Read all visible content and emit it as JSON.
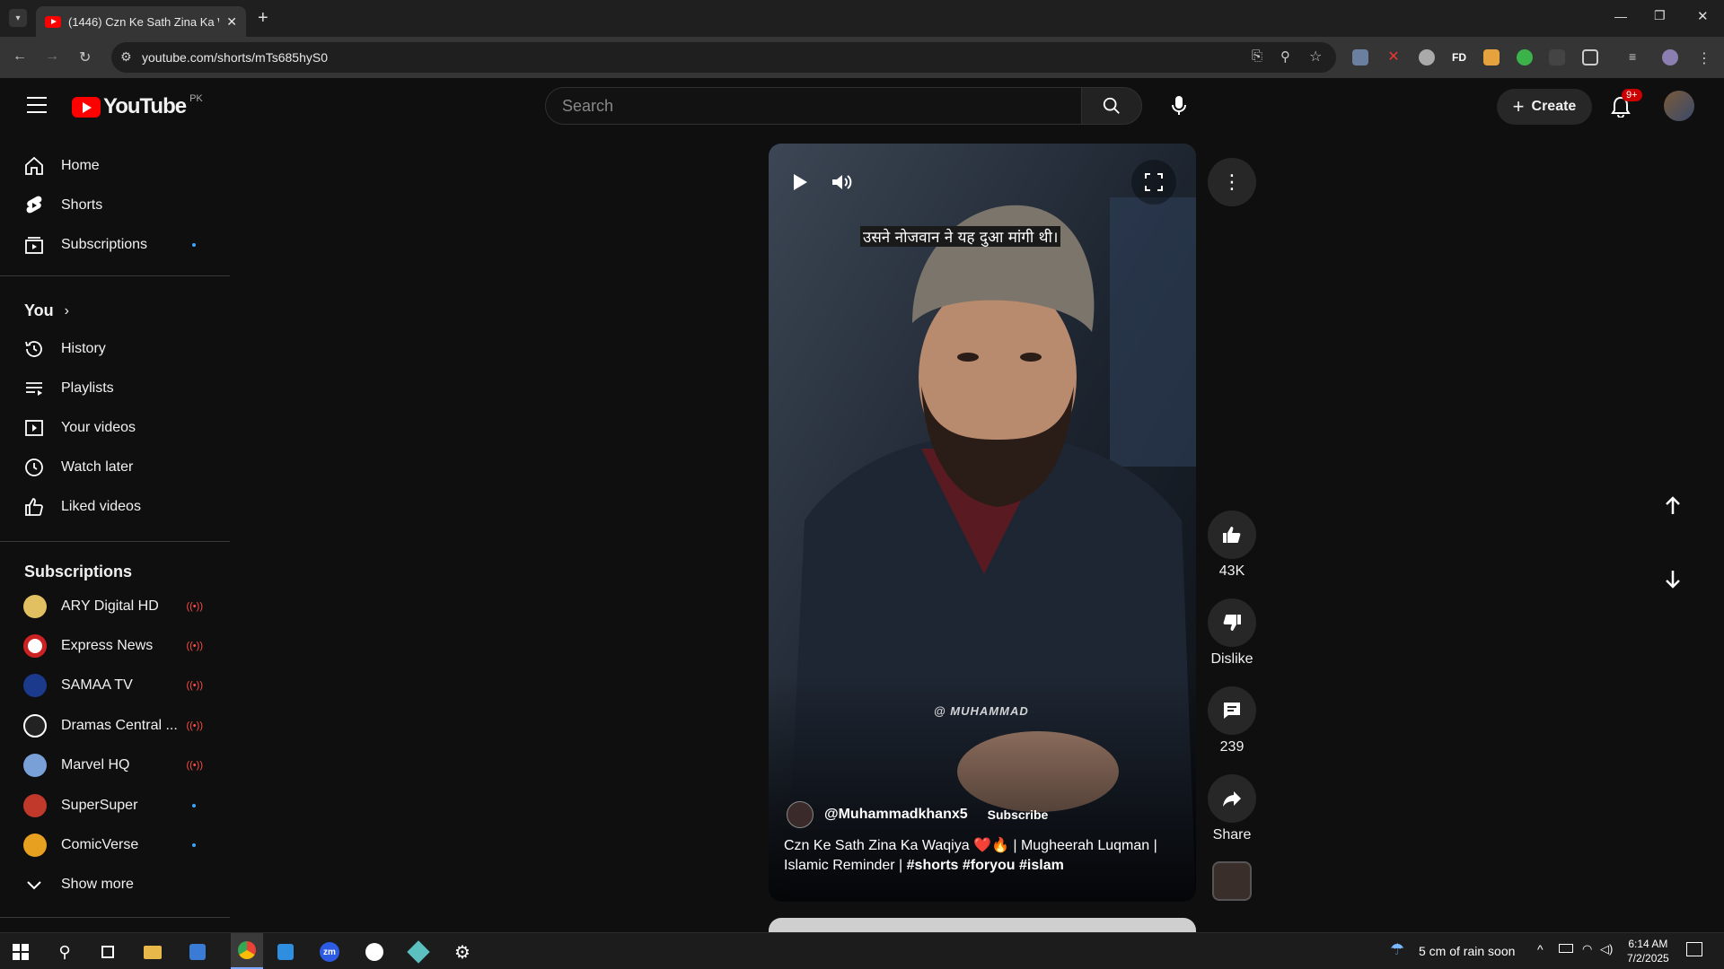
{
  "browser": {
    "tab_title": "(1446) Czn Ke Sath Zina Ka Wa",
    "url": "youtube.com/shorts/mTs685hyS0"
  },
  "header": {
    "logo_text": "YouTube",
    "region": "PK",
    "search_placeholder": "Search",
    "create_label": "Create",
    "notifications_badge": "9+"
  },
  "sidebar": {
    "main": [
      {
        "label": "Home",
        "icon": "home-icon"
      },
      {
        "label": "Shorts",
        "icon": "shorts-icon"
      },
      {
        "label": "Subscriptions",
        "icon": "subscriptions-icon"
      }
    ],
    "you_heading": "You",
    "you_items": [
      {
        "label": "History",
        "icon": "history-icon"
      },
      {
        "label": "Playlists",
        "icon": "playlists-icon"
      },
      {
        "label": "Your videos",
        "icon": "your-videos-icon"
      },
      {
        "label": "Watch later",
        "icon": "watch-later-icon"
      },
      {
        "label": "Liked videos",
        "icon": "liked-videos-icon"
      }
    ],
    "subscriptions_heading": "Subscriptions",
    "subscriptions": [
      {
        "label": "ARY Digital HD",
        "status": "live",
        "color": "#e0c060"
      },
      {
        "label": "Express News",
        "status": "live",
        "color": "#cc2222"
      },
      {
        "label": "SAMAA TV",
        "status": "live",
        "color": "#1b3a8c"
      },
      {
        "label": "Dramas Central ...",
        "status": "live",
        "color": "#222222"
      },
      {
        "label": "Marvel HQ",
        "status": "live",
        "color": "#7aa0d8"
      },
      {
        "label": "SuperSuper",
        "status": "new",
        "color": "#c0392b"
      },
      {
        "label": "ComicVerse",
        "status": "new",
        "color": "#e8a020"
      }
    ],
    "show_more_label": "Show more"
  },
  "video": {
    "caption": "उसने नोजवान ने यह दुआ मांगी थी।",
    "watermark": "@ MUHAMMAD",
    "channel": "@Muhammadkhanx5",
    "subscribe_label": "Subscribe",
    "title_plain": "Czn Ke Sath Zina Ka Waqiya ❤️🔥 | Mugheerah Luqman | Islamic Reminder | ",
    "title_tags": "#shorts #foryou #islam"
  },
  "actions": {
    "likes": "43K",
    "dislike_label": "Dislike",
    "comments": "239",
    "share_label": "Share"
  },
  "taskbar": {
    "weather": "5 cm of rain soon",
    "time": "6:14 AM",
    "date": "7/2/2025"
  }
}
